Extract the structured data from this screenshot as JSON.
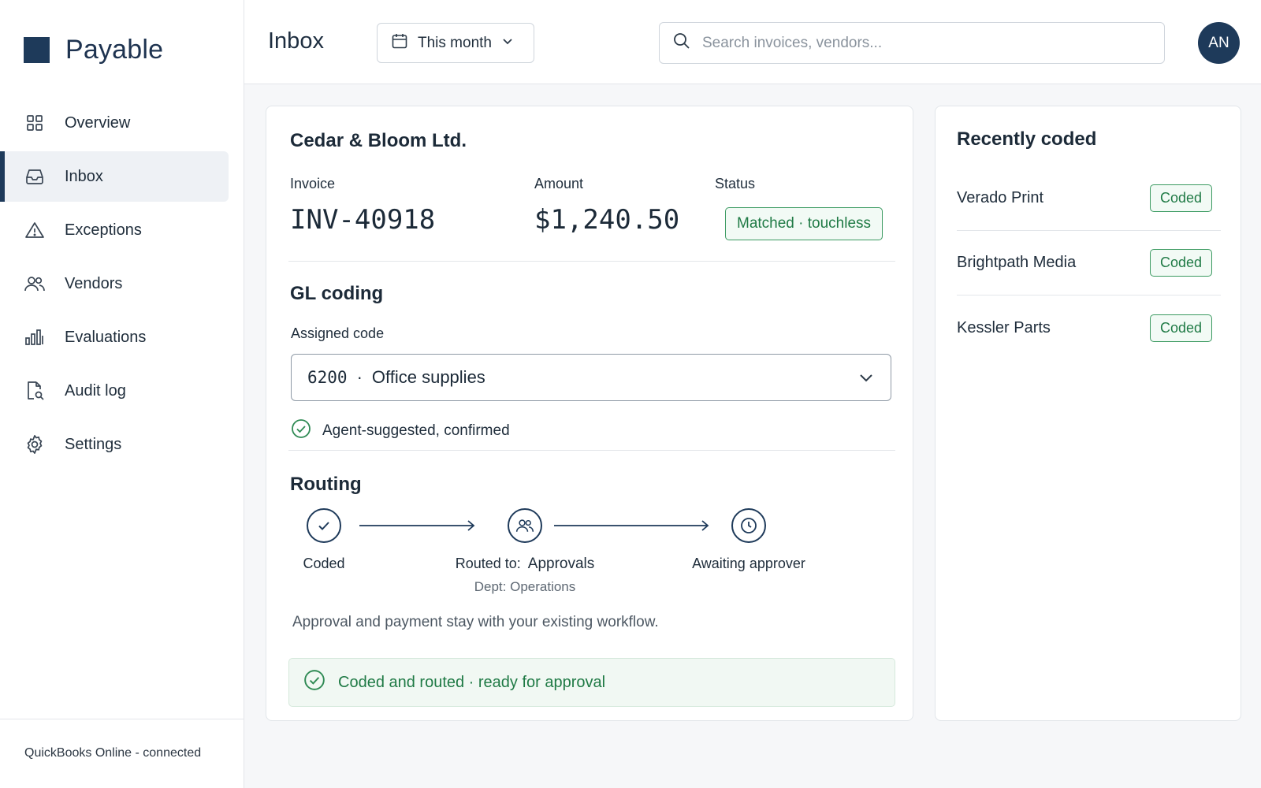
{
  "app": {
    "brand": "Payable",
    "accent_color": "#1e3a5a",
    "success_color": "#1f7a45"
  },
  "sidebar": {
    "items": [
      {
        "label": "Overview",
        "icon": "grid-icon",
        "active": false
      },
      {
        "label": "Inbox",
        "icon": "inbox-icon",
        "active": true
      },
      {
        "label": "Exceptions",
        "icon": "warning-icon",
        "active": false
      },
      {
        "label": "Vendors",
        "icon": "users-icon",
        "active": false
      },
      {
        "label": "Evaluations",
        "icon": "bar-chart-icon",
        "active": false
      },
      {
        "label": "Audit log",
        "icon": "file-search-icon",
        "active": false
      },
      {
        "label": "Settings",
        "icon": "gear-icon",
        "active": false
      }
    ],
    "footer": "QuickBooks Online - connected"
  },
  "header": {
    "title": "Inbox",
    "period": "This month",
    "search_placeholder": "Search invoices, vendors...",
    "avatar_initials": "AN"
  },
  "invoice": {
    "vendor": "Cedar & Bloom Ltd.",
    "invoice_label": "Invoice",
    "invoice_number": "INV-40918",
    "amount_label": "Amount",
    "amount": "$1,240.50",
    "status_label": "Status",
    "status": "Matched · touchless"
  },
  "gl_coding": {
    "title": "GL coding",
    "assigned_label": "Assigned code",
    "code": "6200",
    "separator": "·",
    "code_name": "Office supplies",
    "confirmation": "Agent-suggested, confirmed"
  },
  "routing": {
    "title": "Routing",
    "step1": "Coded",
    "step2_prefix": "Routed to:",
    "step2_value": "Approvals",
    "step2_sub_prefix": "Dept:",
    "step2_sub_value": "Operations",
    "step3": "Awaiting approver",
    "note": "Approval and payment stay with your existing workflow.",
    "banner": "Coded and routed · ready for approval"
  },
  "recent": {
    "title": "Recently coded",
    "items": [
      {
        "vendor": "Verado Print",
        "status": "Coded"
      },
      {
        "vendor": "Brightpath Media",
        "status": "Coded"
      },
      {
        "vendor": "Kessler Parts",
        "status": "Coded"
      }
    ]
  }
}
